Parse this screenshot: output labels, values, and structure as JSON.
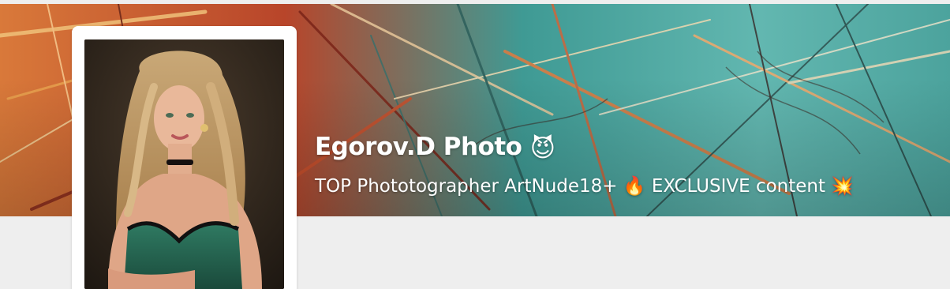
{
  "profile": {
    "name": "Egorov.D Photo",
    "name_emoji": "😈",
    "tagline_part1": "TOP Phototographer ArtNude18+",
    "tagline_emoji1": "🔥",
    "tagline_part2": "EXCLUSIVE content",
    "tagline_emoji2": "💥"
  },
  "banner": {
    "icon": "abstract-brushstroke-cover-image"
  },
  "avatar": {
    "icon": "profile-photo-image"
  },
  "colors": {
    "page_background": "#eeeeee",
    "banner_orange": "#c8622a",
    "banner_teal": "#4da59f",
    "text": "#ffffff"
  }
}
